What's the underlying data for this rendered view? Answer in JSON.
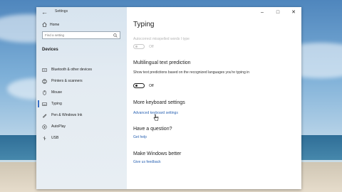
{
  "window": {
    "title": "Settings",
    "controls": [
      "–",
      "□",
      "✕"
    ]
  },
  "sidebar": {
    "home_label": "Home",
    "search_placeholder": "Find a setting",
    "section_label": "Devices",
    "items": [
      {
        "label": "Bluetooth & other devices",
        "icon": "bluetooth-icon"
      },
      {
        "label": "Printers & scanners",
        "icon": "printer-icon"
      },
      {
        "label": "Mouse",
        "icon": "mouse-icon"
      },
      {
        "label": "Typing",
        "icon": "keyboard-icon",
        "active": true
      },
      {
        "label": "Pen & Windows Ink",
        "icon": "pen-icon"
      },
      {
        "label": "AutoPlay",
        "icon": "autoplay-icon"
      },
      {
        "label": "USB",
        "icon": "usb-icon"
      }
    ]
  },
  "main": {
    "title": "Typing",
    "autocorrect_label": "Autocorrect misspelled words I type",
    "autocorrect_state": "Off",
    "multilingual_heading": "Multilingual text prediction",
    "multilingual_desc": "Show text predictions based on the recognized languages you're typing in",
    "multilingual_state": "Off",
    "more_keyboard_heading": "More keyboard settings",
    "advanced_keyboard_link": "Advanced keyboard settings",
    "question_heading": "Have a question?",
    "get_help_link": "Get help",
    "better_heading": "Make Windows better",
    "feedback_link": "Give us feedback"
  },
  "colors": {
    "accent": "#2c64b3",
    "active_indicator": "#3a70c6"
  }
}
